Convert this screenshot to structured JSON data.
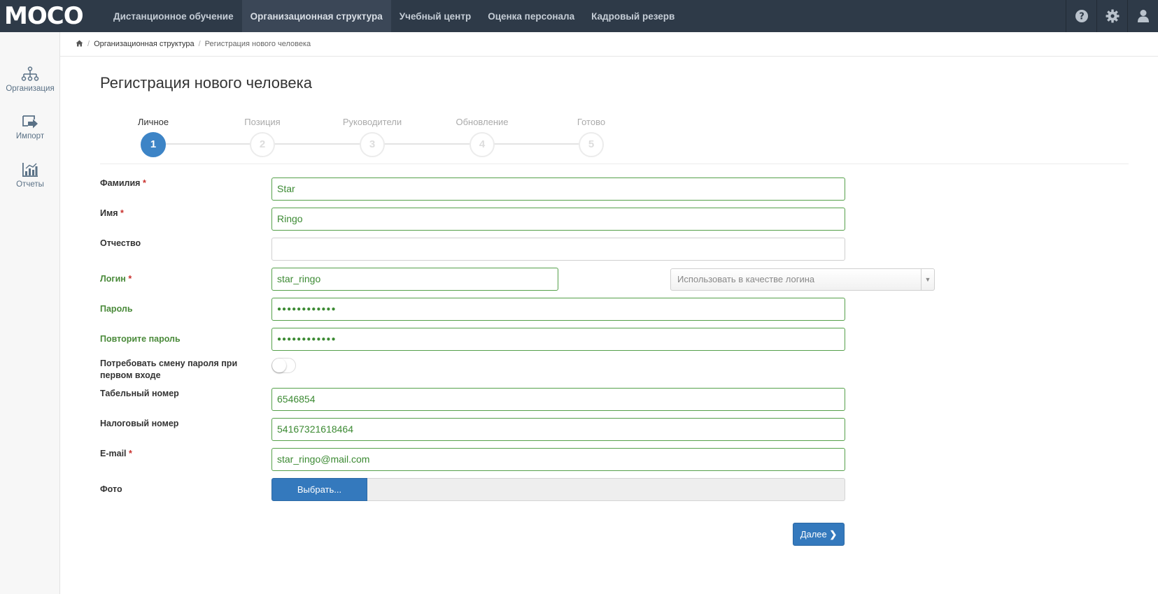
{
  "app": {
    "logo_text": "MOCO"
  },
  "nav": {
    "items": [
      {
        "label": "Дистанционное обучение"
      },
      {
        "label": "Организационная структура"
      },
      {
        "label": "Учебный центр"
      },
      {
        "label": "Оценка персонала"
      },
      {
        "label": "Кадровый резерв"
      }
    ],
    "active_index": 1,
    "icons": [
      "help-icon",
      "gear-icon",
      "user-icon"
    ]
  },
  "sidebar": {
    "items": [
      {
        "label": "Организация",
        "icon": "org-structure-icon"
      },
      {
        "label": "Импорт",
        "icon": "import-icon"
      },
      {
        "label": "Отчеты",
        "icon": "reports-chart-icon"
      }
    ]
  },
  "breadcrumb": {
    "home_icon": "home-icon",
    "items": [
      "Организационная структура",
      "Регистрация нового человека"
    ]
  },
  "page": {
    "title": "Регистрация нового человека"
  },
  "stepper": {
    "steps": [
      {
        "label": "Личное",
        "number": "1"
      },
      {
        "label": "Позиция",
        "number": "2"
      },
      {
        "label": "Руководители",
        "number": "3"
      },
      {
        "label": "Обновление",
        "number": "4"
      },
      {
        "label": "Готово",
        "number": "5"
      }
    ],
    "active_step": 1
  },
  "form": {
    "last_name": {
      "label": "Фамилия",
      "required": "*",
      "value": "Star"
    },
    "first_name": {
      "label": "Имя",
      "required": "*",
      "value": "Ringo"
    },
    "middle_name": {
      "label": "Отчество",
      "value": ""
    },
    "login": {
      "label": "Логин",
      "required": "*",
      "value": "star_ringo",
      "select_placeholder": "Использовать в качестве логина"
    },
    "password": {
      "label": "Пароль",
      "value": "●●●●●●●●●●●●"
    },
    "password_repeat": {
      "label": "Повторите пароль",
      "value": "●●●●●●●●●●●●"
    },
    "require_change": {
      "label": "Потребовать смену пароля при первом входе",
      "checked": false
    },
    "personnel_number": {
      "label": "Табельный номер",
      "value": "6546854"
    },
    "tax_number": {
      "label": "Налоговый номер",
      "value": "54167321618464"
    },
    "email": {
      "label": "E-mail",
      "required": "*",
      "value": "star_ringo@mail.com"
    },
    "photo": {
      "label": "Фото",
      "button_label": "Выбрать..."
    },
    "next_label": "Далее"
  },
  "colors": {
    "topbar": "#2e3a48",
    "accent": "#3479bd",
    "valid": "#55a04a",
    "required": "#c9302c"
  }
}
